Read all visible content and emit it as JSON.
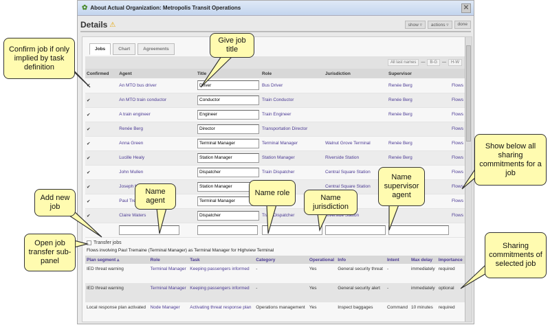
{
  "window": {
    "title": "About Actual Organization: Metropolis Transit Operations",
    "close_icon": "close-icon"
  },
  "header": {
    "title": "Details",
    "show": "show ▿",
    "actions": "actions ▿",
    "done": "done"
  },
  "tabs": [
    "Jobs",
    "Chart",
    "Agreements"
  ],
  "filters": [
    "All last names",
    "—",
    "B-G",
    "—",
    "H-W"
  ],
  "jobs_table": {
    "columns": [
      "Confirmed",
      "Agent",
      "Title",
      "Role",
      "Jurisdiction",
      "Supervisor",
      ""
    ],
    "rows": [
      {
        "agent": "An MTO bus driver",
        "title": "Driver",
        "role": "Bus Driver",
        "jurisdiction": "",
        "supervisor": "Renée Berg",
        "flows": "Flows"
      },
      {
        "agent": "An MTO train conductor",
        "title": "Conductor",
        "role": "Train Conductor",
        "jurisdiction": "",
        "supervisor": "Renée Berg",
        "flows": "Flows"
      },
      {
        "agent": "A train engineer",
        "title": "Engineer",
        "role": "Train Engineer",
        "jurisdiction": "",
        "supervisor": "Renée Berg",
        "flows": "Flows"
      },
      {
        "agent": "Renée Berg",
        "title": "Director",
        "role": "Transportation Director",
        "jurisdiction": "",
        "supervisor": "",
        "flows": "Flows"
      },
      {
        "agent": "Anna Green",
        "title": "Terminal Manager",
        "role": "Terminal Manager",
        "jurisdiction": "Walnut Grove Terminal",
        "supervisor": "Renée Berg",
        "flows": "Flows"
      },
      {
        "agent": "Lucille Healy",
        "title": "Station Manager",
        "role": "Station Manager",
        "jurisdiction": "Riverside Station",
        "supervisor": "Renée Berg",
        "flows": "Flows"
      },
      {
        "agent": "John Mullen",
        "title": "Dispatcher",
        "role": "Train Dispatcher",
        "jurisdiction": "Central Square Station",
        "supervisor": "",
        "flows": "Flows"
      },
      {
        "agent": "Joseph N",
        "title": "Station Manager",
        "role": "S",
        "jurisdiction": "Central Square Station",
        "supervisor": "",
        "flows": "Flows"
      },
      {
        "agent": "Paul Trem",
        "title": "Terminal Manager",
        "role": "T",
        "jurisdiction": "Hig",
        "supervisor": "",
        "flows": "Flows"
      },
      {
        "agent": "Claire Waters",
        "title": "Dispatcher",
        "role": "Train Dispatcher",
        "jurisdiction": "Riverside Station",
        "supervisor": "",
        "flows": "Flows"
      }
    ]
  },
  "transfer_jobs": "Transfer jobs",
  "flows_caption": "Flows involving Paul Tremaine (Terminal Manager) as Terminal Manager for Highview Terminal",
  "flows_table": {
    "columns": [
      "Plan segment ▵",
      "Role",
      "Task",
      "Category",
      "Operational",
      "Info",
      "Intent",
      "Max delay",
      "Importance"
    ],
    "rows": [
      [
        "IED threat warning",
        "Terminal Manager",
        "Keeping passengers informed",
        "-",
        "Yes",
        "General security threat",
        "-",
        "immediately",
        "required"
      ],
      [
        "IED threat warning",
        "Terminal Manager",
        "Keeping passengers informed",
        "-",
        "Yes",
        "General security alert",
        "-",
        "immediately",
        "optional"
      ],
      [
        "Local response plan activated",
        "Node Manager",
        "Activating threat response plan",
        "Operations management",
        "Yes",
        "Inspect baggages",
        "Command",
        "10 minutes",
        "required"
      ]
    ]
  },
  "callouts": {
    "confirm": "Confirm job if only implied by task definition",
    "title": "Give job title",
    "add": "Add new job",
    "transfer": "Open job transfer sub-panel",
    "agent": "Name agent",
    "role": "Name role",
    "jurisdiction": "Name jurisdiction",
    "supervisor": "Name supervisor agent",
    "flows": "Show below all sharing commitments for a job",
    "sharing": "Sharing commitments of selected job"
  }
}
